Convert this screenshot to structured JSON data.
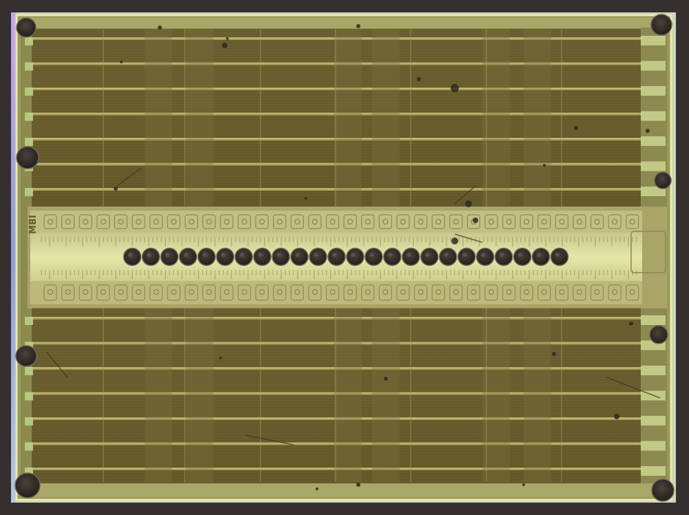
{
  "image": {
    "subject": "silicon-die-micrograph",
    "die_marking": "MBI",
    "center_bond_pad_count": 24,
    "edge_bond_pad_count": 8
  },
  "colors": {
    "background": "#35302f",
    "die_field": "#6e6232",
    "die_field_dark": "#5c5226",
    "rail": "#b3a964",
    "rail_bright": "#e3e49a",
    "pad": "#2b2622",
    "pad_rim": "#6f6457",
    "edge_glow_left": "#b08ad8",
    "edge_glow_right": "#d9eec3"
  }
}
